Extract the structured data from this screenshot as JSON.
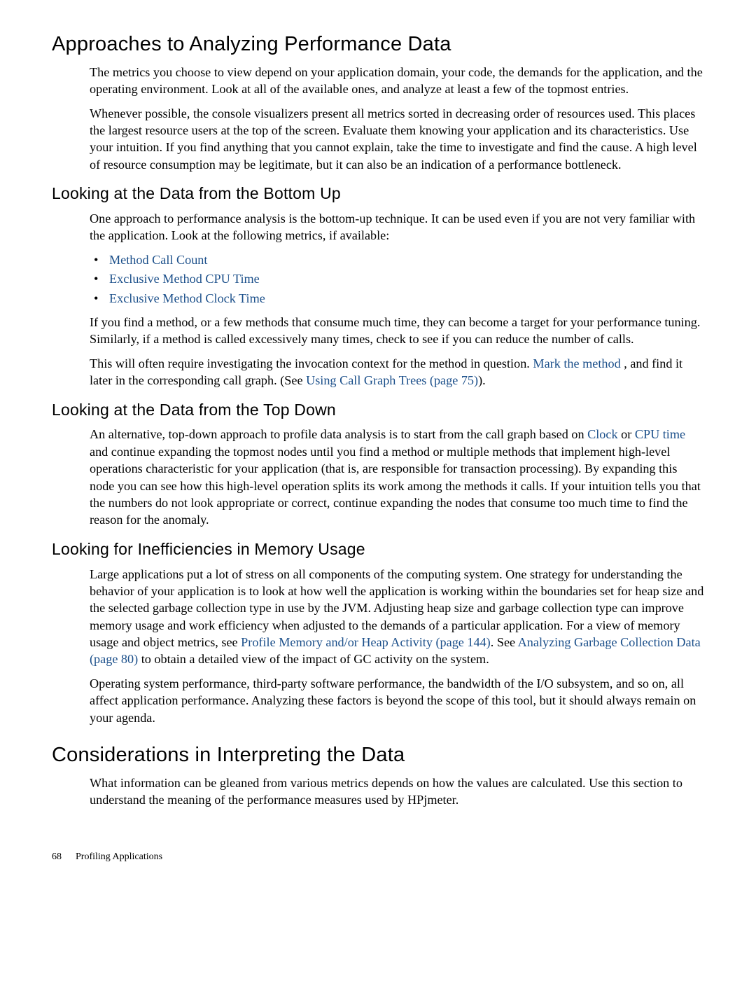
{
  "h1_approaches": "Approaches to Analyzing Performance Data",
  "p_approaches_1": "The metrics you choose to view depend on your application domain, your code, the demands for the application, and the operating environment. Look at all of the available ones, and analyze at least a few of the topmost entries.",
  "p_approaches_2": "Whenever possible, the console visualizers present all metrics sorted in decreasing order of resources used. This places the largest resource users at the top of the screen. Evaluate them knowing your application and its characteristics. Use your intuition. If you find anything that you cannot explain, take the time to investigate and find the cause. A high level of resource consumption may be legitimate, but it can also be an indication of a performance bottleneck.",
  "h2_bottom_up": "Looking at the Data from the Bottom Up",
  "p_bottom_1": "One approach to performance analysis is the bottom-up technique. It can be used even if you are not very familiar with the application. Look at the following metrics, if available:",
  "li_method_call_count": "Method Call Count",
  "li_excl_cpu": "Exclusive Method CPU Time",
  "li_excl_clock": "Exclusive Method Clock Time",
  "p_bottom_2": "If you find a method, or a few methods that consume much time, they can become a target for your performance tuning. Similarly, if a method is called excessively many times, check to see if you can reduce the number of calls.",
  "p_bottom_3a": "This will often require investigating the invocation context for the method in question. ",
  "link_mark_the_method": "Mark the method ",
  "p_bottom_3b": ", and find it later in the corresponding call graph. (See ",
  "link_using_call_graph": "Using Call Graph Trees (page 75)",
  "p_bottom_3c": ").",
  "h2_top_down": "Looking at the Data from the Top Down",
  "p_top_1a": "An alternative, top-down approach to profile data analysis is to start from the call graph based on ",
  "link_clock": "Clock",
  "p_top_1b": " or ",
  "link_cpu_time": "CPU time",
  "p_top_1c": " and continue expanding the topmost nodes until you find a method or multiple methods that implement high-level operations characteristic for your application (that is, are responsible for transaction processing). By expanding this node you can see how this high-level operation splits its work among the methods it calls. If your intuition tells you that the numbers do not look appropriate or correct, continue expanding the nodes that consume too much time to find the reason for the anomaly.",
  "h2_mem": "Looking for Inefficiencies in Memory Usage",
  "p_mem_1a": "Large applications put a lot of stress on all components of the computing system. One strategy for understanding the behavior of your application is to look at how well the application is working within the boundaries set for heap size and the selected garbage collection type in use by the JVM. Adjusting heap size and garbage collection type can improve memory usage and work efficiency when adjusted to the demands of a particular application. For a view of memory usage and object metrics, see ",
  "link_profile_mem": "Profile Memory and/or Heap Activity (page 144)",
  "p_mem_1b": ". See ",
  "link_analyzing_gc": "Analyzing Garbage Collection Data  (page 80)",
  "p_mem_1c": " to obtain a detailed view of the impact of GC activity on the system.",
  "p_mem_2": "Operating system performance, third-party software performance, the bandwidth of the I/O subsystem, and so on, all affect application performance. Analyzing these factors is beyond the scope of this tool, but it should always remain on your agenda.",
  "h1_considerations": "Considerations in Interpreting the Data",
  "p_cons_1": "What information can be gleaned from various metrics depends on how the values are calculated. Use this section to understand the meaning of the performance measures used by HPjmeter.",
  "footer_page": "68",
  "footer_title": "Profiling Applications"
}
